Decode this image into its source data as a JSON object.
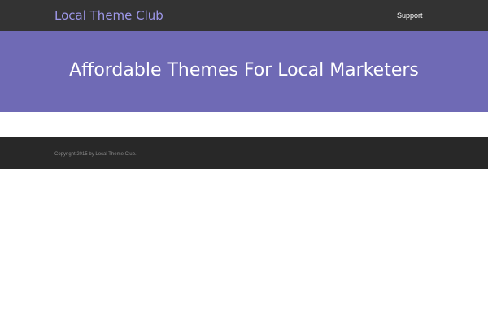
{
  "header": {
    "site_title": "Local Theme Club",
    "nav": [
      {
        "label": "Support"
      }
    ]
  },
  "hero": {
    "title": "Affordable Themes For Local Marketers"
  },
  "footer": {
    "copyright": "Copyright 2015 by Local Theme Club."
  },
  "colors": {
    "header_bg": "#333333",
    "accent_link": "#9d97e8",
    "hero_bg": "#6f6ab5",
    "footer_bg": "#282828",
    "footer_text": "#888888"
  }
}
